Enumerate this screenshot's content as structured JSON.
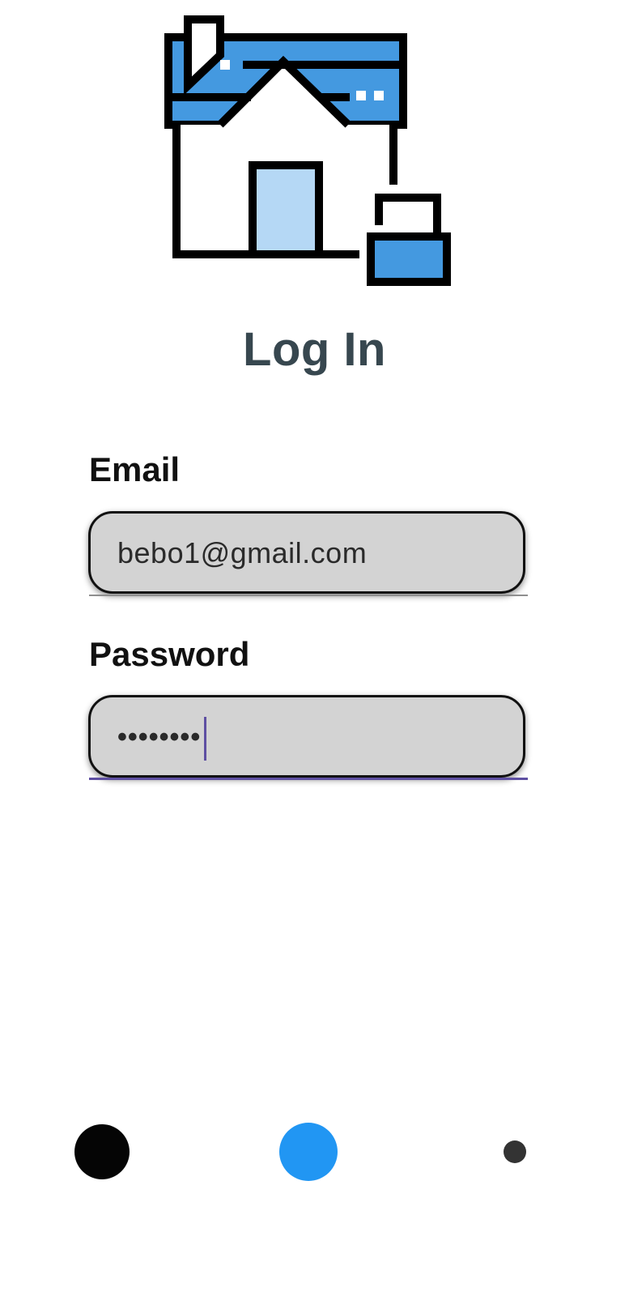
{
  "login": {
    "title": "Log In",
    "email": {
      "label": "Email",
      "value": "bebo1@gmail.com"
    },
    "password": {
      "label": "Password",
      "value": "••••••••"
    }
  },
  "logo": {
    "icon": "house-lock-icon"
  },
  "bottom_nav": {
    "items": [
      {
        "icon": "nav-dot-black"
      },
      {
        "icon": "nav-dot-blue"
      },
      {
        "icon": "nav-dot-gray"
      }
    ]
  },
  "colors": {
    "accent_blue": "#2196f3",
    "cursor_purple": "#5e4fa2",
    "title": "#37474f",
    "field_bg": "#d3d3d3"
  }
}
